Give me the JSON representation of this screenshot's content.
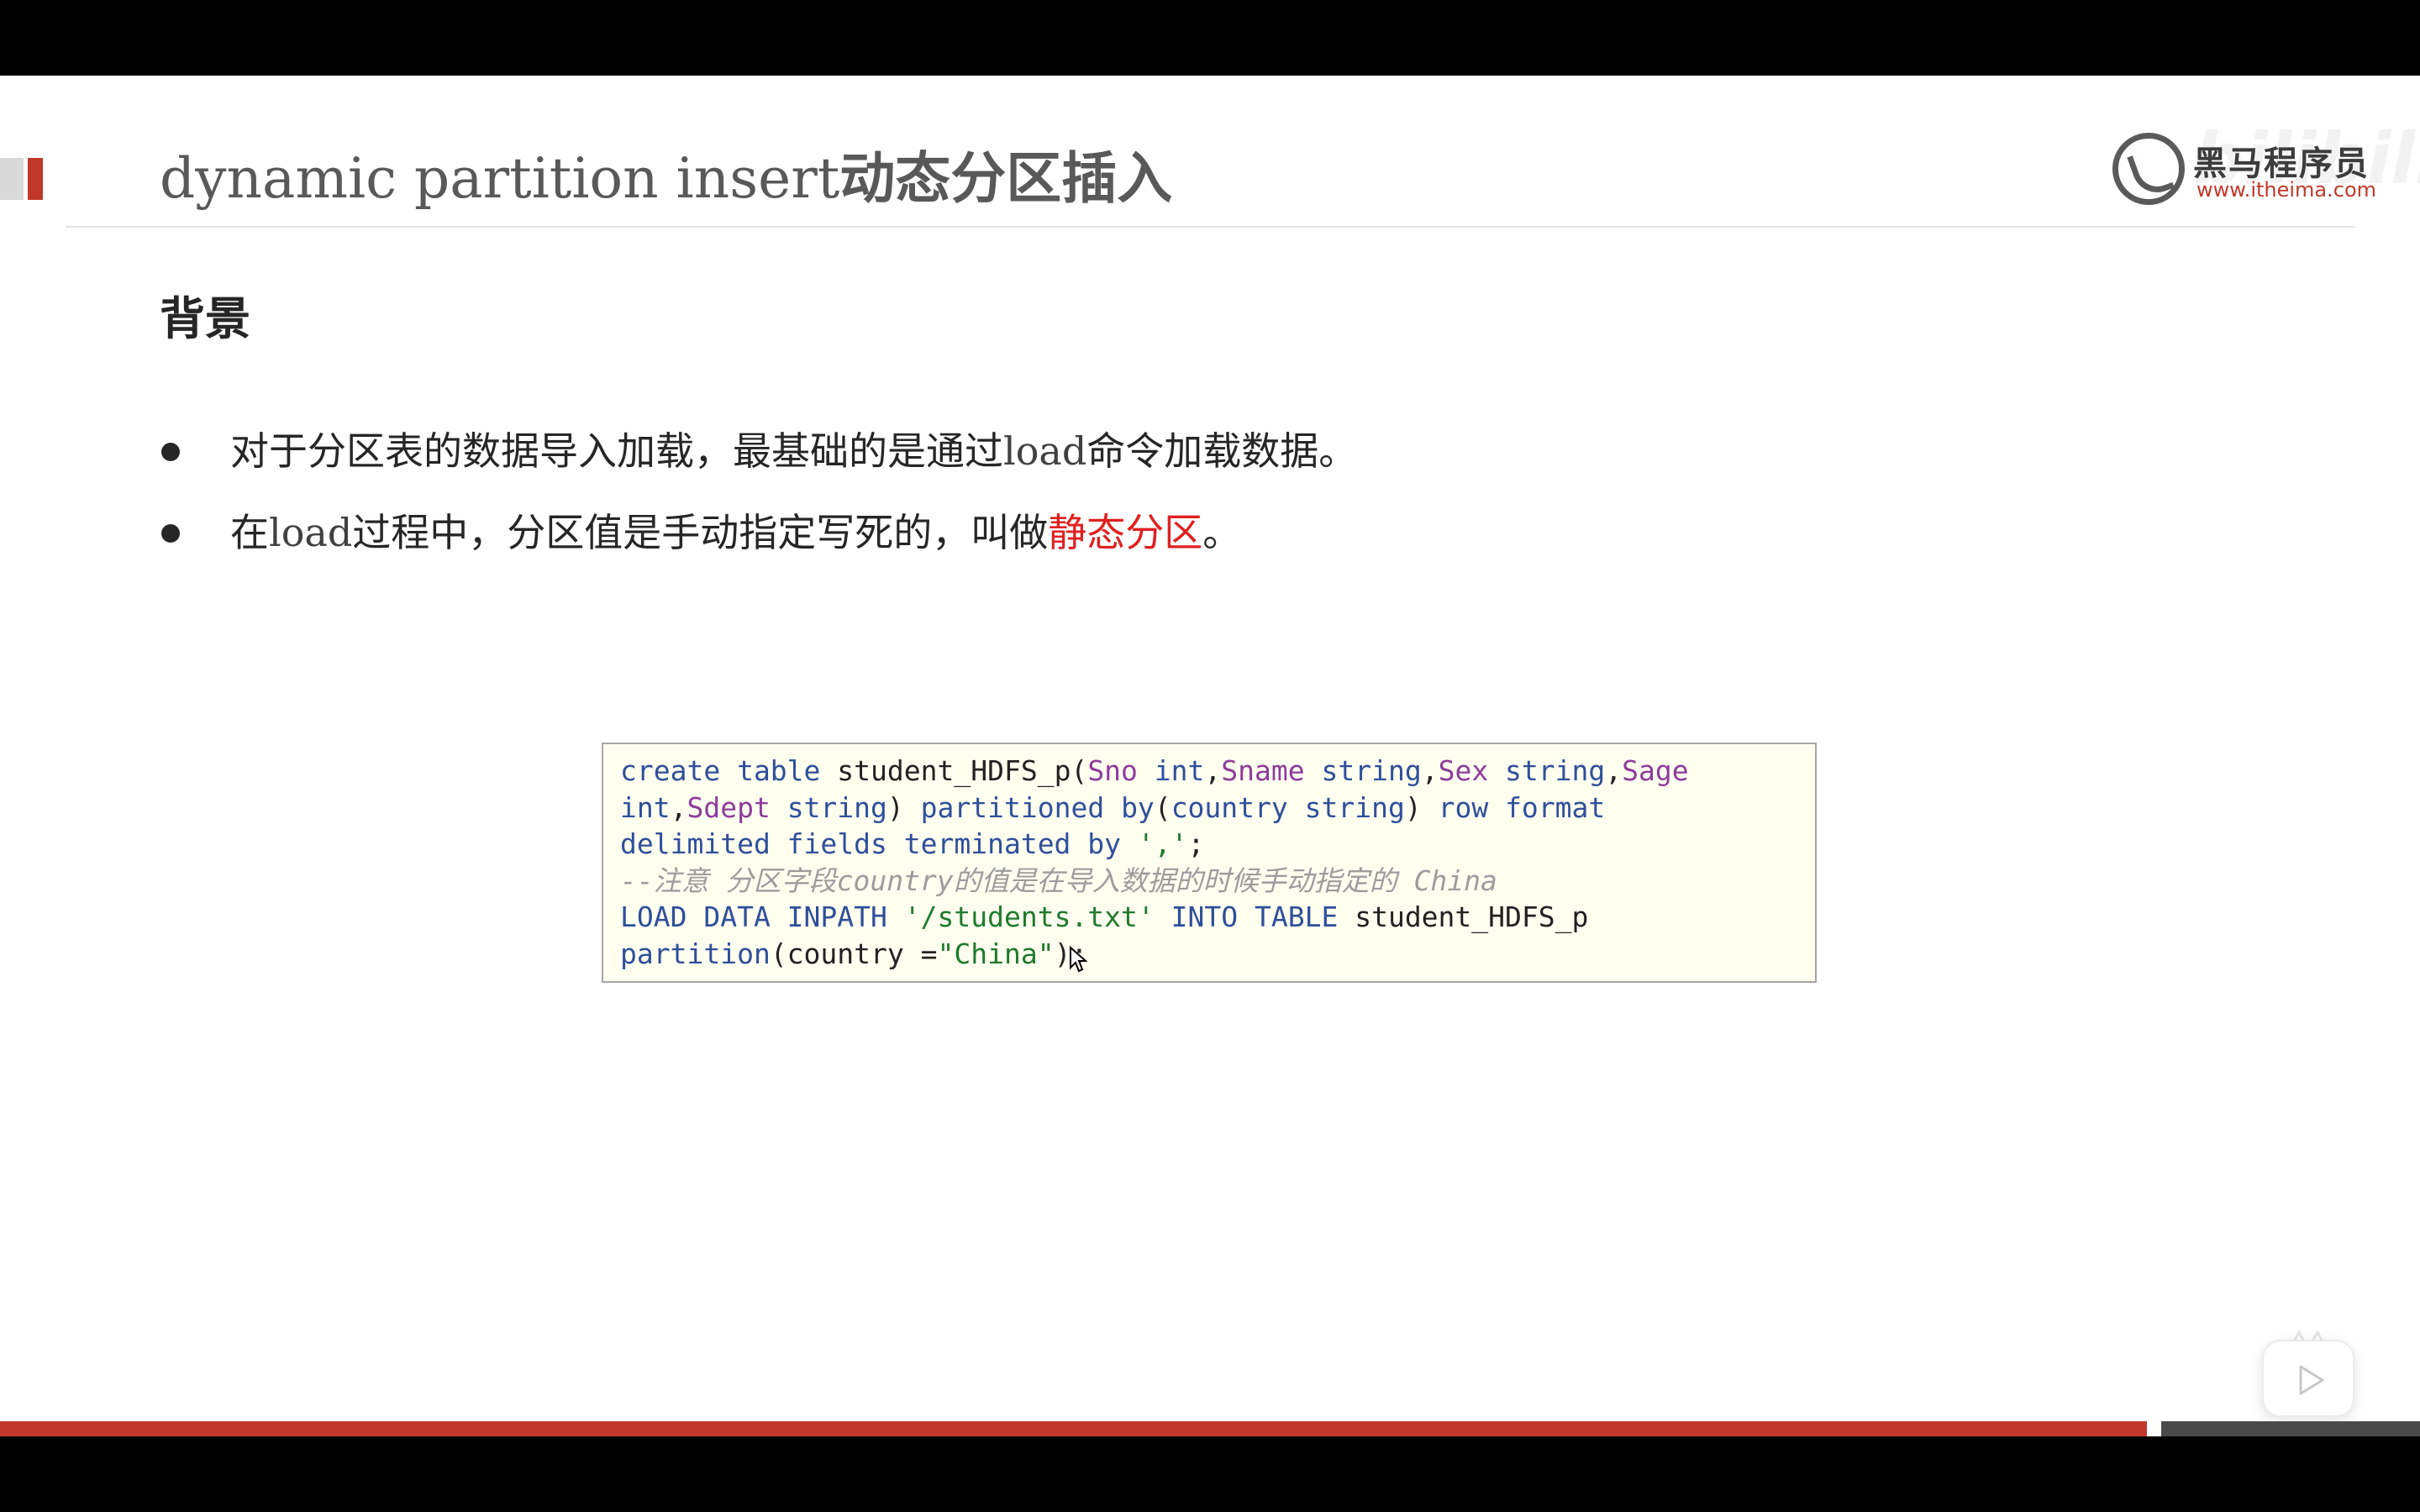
{
  "slide": {
    "title_en": "dynamic partition insert",
    "title_zh": "动态分区插入",
    "logo": {
      "name": "黑马程序员",
      "url": "www.itheima.com"
    },
    "watermark": "bilibili",
    "section_heading": "背景",
    "bullets": [
      {
        "before": "对于分区表的数据导入加载，最基础的是通过",
        "code": "load",
        "after": "命令加载数据。"
      },
      {
        "before": "在",
        "code": "load",
        "middle": "过程中，分区值是手动指定写死的，叫做",
        "highlight": "静态分区",
        "after": "。"
      }
    ],
    "code": {
      "l1": {
        "a": "create table",
        "b": " student_HDFS_p(",
        "c": "Sno",
        "d": " int",
        "e": ",",
        "f": "Sname",
        "g": " string",
        "h": ",",
        "i": "Sex",
        "j": " string",
        "k": ",",
        "l": "Sage"
      },
      "l2": {
        "a": "int",
        "b": ",",
        "c": "Sdept",
        "d": " string",
        "e": ") ",
        "f": "partitioned by",
        "g": "(",
        "h": "country string",
        "i": ") ",
        "j": "row format"
      },
      "l3": {
        "a": "delimited fields terminated by",
        "b": " ",
        "c": "','",
        "d": ";"
      },
      "l4": {
        "a": "--注意 分区字段country的值是在导入数据的时候手动指定的 China"
      },
      "l5": {
        "a": "LOAD DATA INPATH",
        "b": " ",
        "c": "'/students.txt'",
        "d": " ",
        "e": "INTO TABLE",
        "f": " student_HDFS_p"
      },
      "l6": {
        "a": "partition",
        "b": "(country =",
        "c": "\"China\"",
        "d": ");"
      }
    }
  },
  "colors": {
    "accent_red": "#c0392b",
    "highlight_red": "#e02020",
    "keyword_blue": "#2f4f9a",
    "column_purple": "#8e3c9b",
    "string_green": "#1f7a2e",
    "comment_gray": "#9c9c9c",
    "code_background": "#fffff0"
  },
  "controls": {
    "nav_icons": [
      "previous-icon",
      "next-icon",
      "pen-icon",
      "slides-icon",
      "zoom-icon",
      "more-icon"
    ],
    "play_icon": "play-icon"
  }
}
